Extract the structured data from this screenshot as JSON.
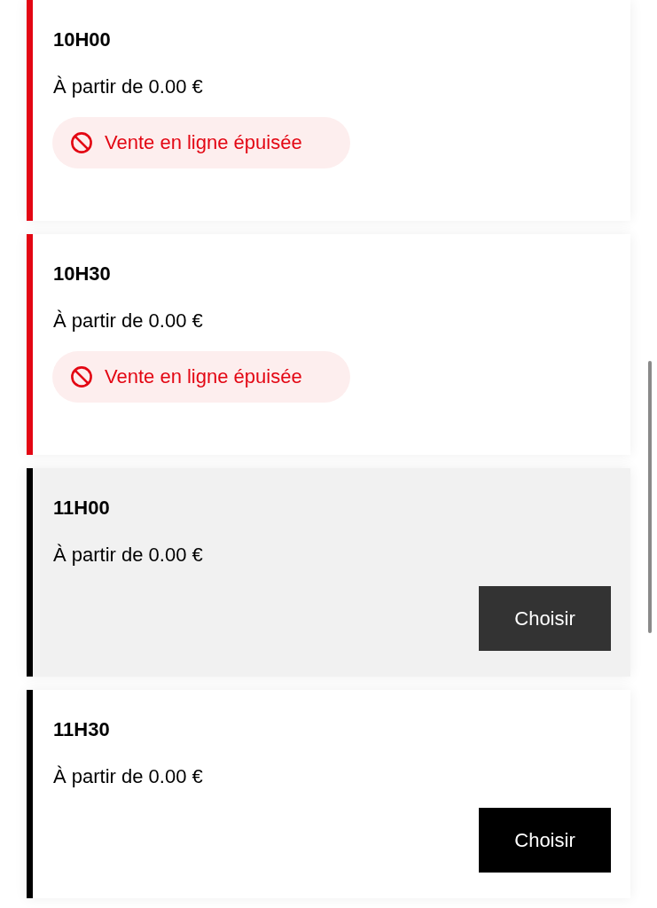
{
  "slots": [
    {
      "time": "10H00",
      "price": "À partir de 0.00 €",
      "kind": "sold_out",
      "highlighted": false,
      "badge": "Vente en ligne épuisée"
    },
    {
      "time": "10H30",
      "price": "À partir de 0.00 €",
      "kind": "sold_out",
      "highlighted": false,
      "badge": "Vente en ligne épuisée"
    },
    {
      "time": "11H00",
      "price": "À partir de 0.00 €",
      "kind": "available",
      "highlighted": true,
      "button": "Choisir"
    },
    {
      "time": "11H30",
      "price": "À partir de 0.00 €",
      "kind": "available",
      "highlighted": false,
      "button": "Choisir"
    }
  ]
}
